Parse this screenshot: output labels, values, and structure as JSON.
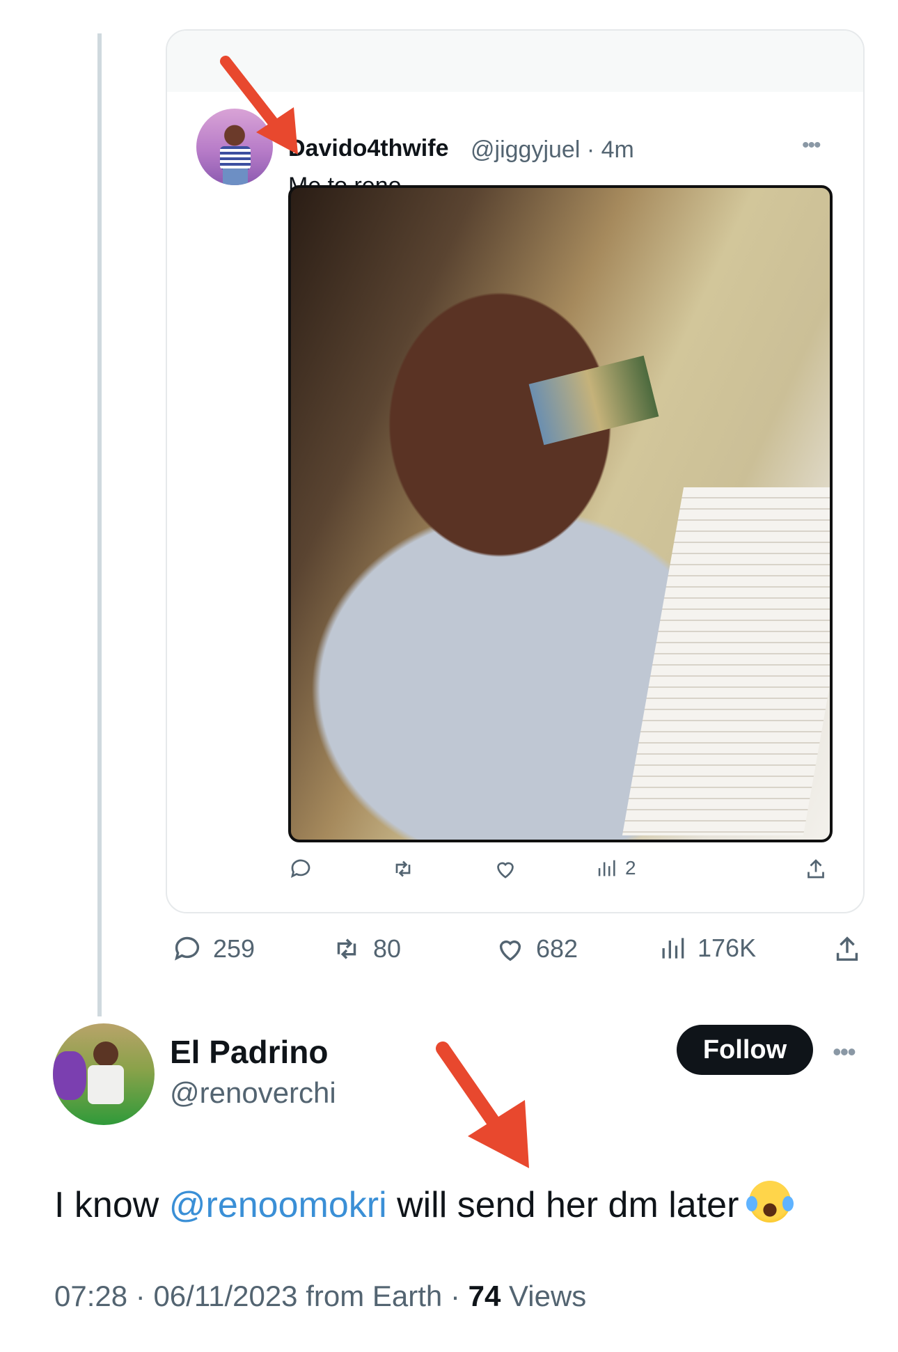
{
  "quote": {
    "display_name": "Davido4thwife",
    "handle": "@jiggyjuel",
    "separator": "·",
    "time": "4m",
    "text": "Me to reno",
    "actions": {
      "replies": "",
      "reposts": "",
      "likes": "",
      "views": "2"
    }
  },
  "actions": {
    "replies": "259",
    "reposts": "80",
    "likes": "682",
    "views": "176K"
  },
  "author": {
    "display_name": "El Padrino",
    "handle": "@renoverchi",
    "follow_label": "Follow"
  },
  "post": {
    "text_before": "I know ",
    "mention": "@renoomokri",
    "text_after": "  will send her dm later "
  },
  "meta": {
    "time": "07:28",
    "sep1": "·",
    "date": "06/11/2023",
    "source": "from Earth",
    "sep2": "·",
    "views_count": "74",
    "views_label": "Views"
  },
  "colors": {
    "mention": "#3a8fd6",
    "annotation_arrow": "#e8482e",
    "follow_bg": "#0f1419"
  },
  "icons": [
    "reply-icon",
    "repost-icon",
    "like-icon",
    "views-icon",
    "share-icon",
    "more-icon",
    "laughing-crying-emoji"
  ]
}
